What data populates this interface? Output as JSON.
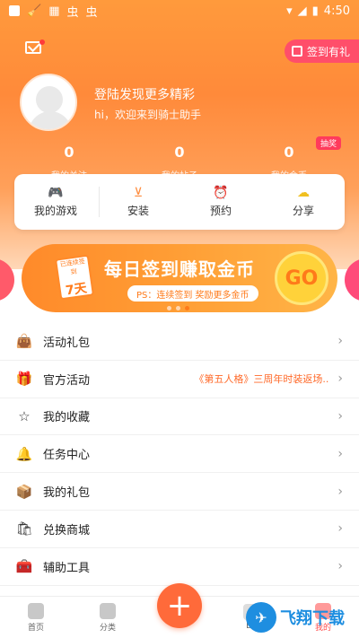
{
  "status": {
    "time": "4:50",
    "left_text_1": "虫",
    "left_text_2": "虫"
  },
  "header": {
    "sign_in_label": "签到有礼",
    "login_title": "登陆发现更多精彩",
    "login_subtitle": "hi，欢迎来到骑士助手",
    "lottery_badge": "抽奖"
  },
  "stats": [
    {
      "value": "0",
      "label": "我的关注"
    },
    {
      "value": "0",
      "label": "我的帖子"
    },
    {
      "value": "0",
      "label": "我的金币"
    }
  ],
  "quick_actions": [
    {
      "label": "我的游戏"
    },
    {
      "label": "安装"
    },
    {
      "label": "预约"
    },
    {
      "label": "分享"
    }
  ],
  "banner": {
    "title": "每日签到赚取金币",
    "subtitle": "PS：连续签到 奖励更多金币",
    "go": "GO",
    "cal_top": "已连续签到",
    "cal_num": "7天"
  },
  "menu": [
    {
      "label": "活动礼包",
      "note": ""
    },
    {
      "label": "官方活动",
      "note": "《第五人格》三周年时装返场.."
    },
    {
      "label": "我的收藏",
      "note": ""
    },
    {
      "label": "任务中心",
      "note": ""
    },
    {
      "label": "我的礼包",
      "note": ""
    },
    {
      "label": "兑换商城",
      "note": ""
    },
    {
      "label": "辅助工具",
      "note": ""
    }
  ],
  "tabs": [
    {
      "label": "首页"
    },
    {
      "label": "分类"
    },
    {
      "label": ""
    },
    {
      "label": "BT"
    },
    {
      "label": "我的"
    }
  ],
  "watermark": {
    "text": "飞翔下载"
  },
  "colors": {
    "accent": "#ff8a3a",
    "pill": "#ff4e6a"
  }
}
